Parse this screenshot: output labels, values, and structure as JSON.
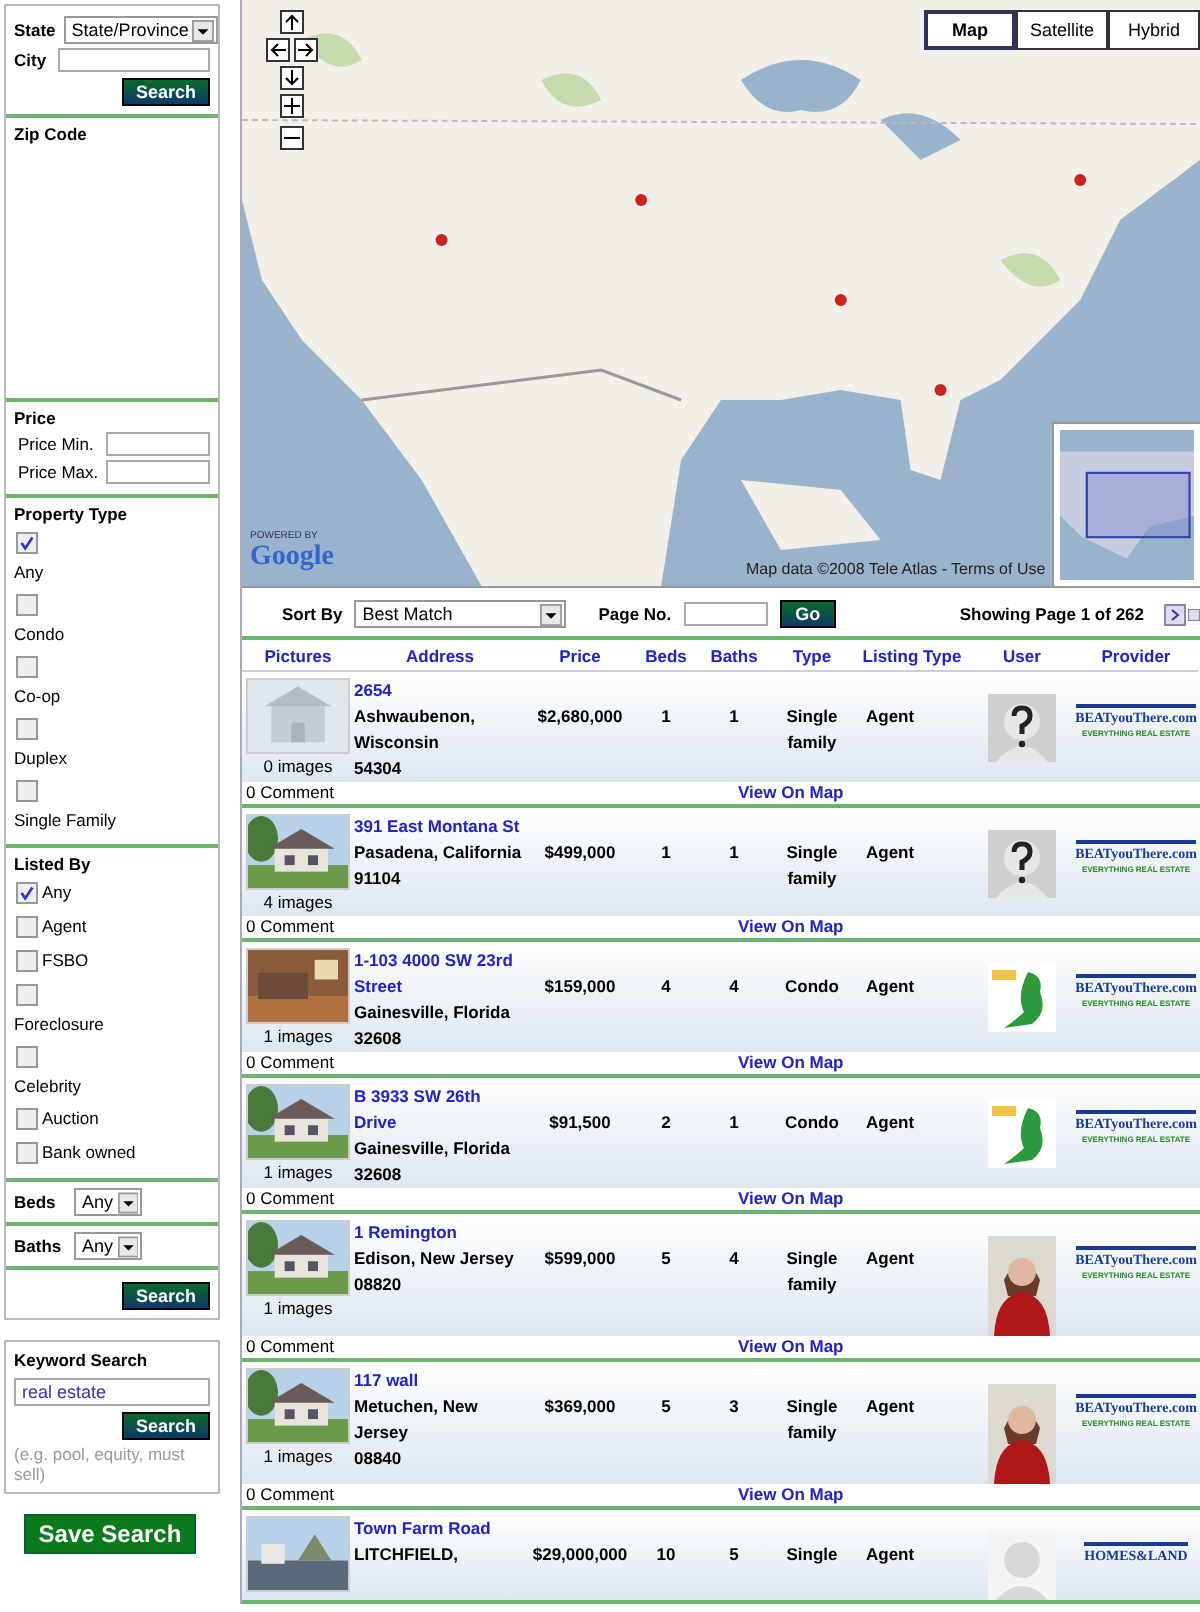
{
  "search_form": {
    "state": {
      "label": "State",
      "value": "State/Province"
    },
    "city": {
      "label": "City"
    },
    "search_button": "Search",
    "zip_code": {
      "label": "Zip Code"
    },
    "price": {
      "title": "Price",
      "fields": [
        {
          "label": "Price Min."
        },
        {
          "label": "Price Max."
        }
      ]
    },
    "property_type": {
      "title": "Property Type",
      "options": [
        {
          "label": "Any",
          "checked": true,
          "kind": "stacked"
        },
        {
          "label": "Condo",
          "checked": false,
          "kind": "stacked"
        },
        {
          "label": "Co-op",
          "checked": false,
          "kind": "stacked"
        },
        {
          "label": "Duplex",
          "checked": false,
          "kind": "stacked"
        },
        {
          "label": "Single Family",
          "checked": false,
          "kind": "stacked"
        }
      ]
    },
    "listed_by": {
      "title": "Listed By",
      "options": [
        {
          "label": "Any",
          "checked": true,
          "kind": "inline"
        },
        {
          "label": "Agent",
          "checked": false,
          "kind": "inline"
        },
        {
          "label": "FSBO",
          "checked": false,
          "kind": "inline"
        },
        {
          "label": "Foreclosure",
          "checked": false,
          "kind": "stacked"
        },
        {
          "label": "Celebrity",
          "checked": false,
          "kind": "stacked"
        },
        {
          "label": "Auction",
          "checked": false,
          "kind": "inline"
        },
        {
          "label": "Bank owned",
          "checked": false,
          "kind": "inline"
        }
      ]
    },
    "selects": [
      {
        "label": "Beds",
        "value": "Any"
      },
      {
        "label": "Baths",
        "value": "Any"
      }
    ],
    "bottom_search_button": "Search"
  },
  "keyword_search": {
    "title": "Keyword Search",
    "value": "real estate",
    "button": "Search",
    "hint": "(e.g. pool, equity, must sell)"
  },
  "save_button": "Save Search",
  "map": {
    "map_types": [
      {
        "label": "Map",
        "selected": true
      },
      {
        "label": "Satellite",
        "selected": false
      },
      {
        "label": "Hybrid",
        "selected": false
      }
    ],
    "powered_by": "POWERED BY",
    "logo": "Google",
    "attribution": "Map data ©2008 Tele Atlas - Terms of Use"
  },
  "results": {
    "sort_label": "Sort By",
    "sort_value": "Best Match",
    "page_label": "Page No.",
    "go_button": "Go",
    "showing": "Showing Page 1 of 262",
    "columns": [
      "Pictures",
      "Address",
      "Price",
      "Beds",
      "Baths",
      "Type",
      "Listing Type",
      "User",
      "Provider"
    ],
    "rows": [
      {
        "photo": {
          "kind": "placeholder"
        },
        "images": "0 images",
        "street": "2654",
        "city": "Ashwaubenon, Wisconsin",
        "zip": "54304",
        "price": "$2,680,000",
        "beds": "1",
        "baths": "1",
        "type": "Single family",
        "listing_type": "Agent",
        "user": {
          "kind": "unknown"
        },
        "provider": {
          "name": "BEATyouThere.com",
          "tagline": "EVERYTHING REAL ESTATE"
        },
        "comments": "0 Comment",
        "map_link": "View On Map"
      },
      {
        "photo": {
          "kind": "house"
        },
        "images": "4 images",
        "street": "391 East Montana St",
        "city": "Pasadena, California",
        "zip": "91104",
        "price": "$499,000",
        "beds": "1",
        "baths": "1",
        "type": "Single family",
        "listing_type": "Agent",
        "user": {
          "kind": "unknown"
        },
        "provider": {
          "name": "BEATyouThere.com",
          "tagline": "EVERYTHING REAL ESTATE"
        },
        "comments": "0 Comment",
        "map_link": "View On Map"
      },
      {
        "photo": {
          "kind": "interior"
        },
        "images": "1 images",
        "street": "1-103 4000 SW 23rd Street",
        "city": "Gainesville, Florida",
        "zip": "32608",
        "price": "$159,000",
        "beds": "4",
        "baths": "4",
        "type": "Condo",
        "listing_type": "Agent",
        "user": {
          "kind": "agency"
        },
        "provider": {
          "name": "BEATyouThere.com",
          "tagline": "EVERYTHING REAL ESTATE"
        },
        "comments": "0 Comment",
        "map_link": "View On Map"
      },
      {
        "photo": {
          "kind": "house"
        },
        "images": "1 images",
        "street": "B 3933 SW 26th Drive",
        "city": "Gainesville, Florida",
        "zip": "32608",
        "price": "$91,500",
        "beds": "2",
        "baths": "1",
        "type": "Condo",
        "listing_type": "Agent",
        "user": {
          "kind": "agency"
        },
        "provider": {
          "name": "BEATyouThere.com",
          "tagline": "EVERYTHING REAL ESTATE"
        },
        "comments": "0 Comment",
        "map_link": "View On Map"
      },
      {
        "photo": {
          "kind": "house"
        },
        "images": "1 images",
        "street": "1 Remington",
        "city": "Edison, New Jersey",
        "zip": "08820",
        "price": "$599,000",
        "beds": "5",
        "baths": "4",
        "type": "Single family",
        "listing_type": "Agent",
        "user": {
          "kind": "agent"
        },
        "provider": {
          "name": "BEATyouThere.com",
          "tagline": "EVERYTHING REAL ESTATE"
        },
        "comments": "0 Comment",
        "map_link": "View On Map"
      },
      {
        "photo": {
          "kind": "house"
        },
        "images": "1 images",
        "street": "117 wall",
        "city": "Metuchen, New Jersey",
        "zip": "08840",
        "price": "$369,000",
        "beds": "5",
        "baths": "3",
        "type": "Single family",
        "listing_type": "Agent",
        "user": {
          "kind": "agent"
        },
        "provider": {
          "name": "BEATyouThere.com",
          "tagline": "EVERYTHING REAL ESTATE"
        },
        "comments": "0 Comment",
        "map_link": "View On Map"
      },
      {
        "photo": {
          "kind": "harbor"
        },
        "street": "Town Farm Road",
        "city": "LITCHFIELD,",
        "price": "$29,000,000",
        "beds": "10",
        "baths": "5",
        "type": "Single",
        "listing_type": "Agent",
        "user": {
          "kind": "silhouette"
        },
        "provider": {
          "name": "HOMES&LAND"
        }
      }
    ]
  }
}
